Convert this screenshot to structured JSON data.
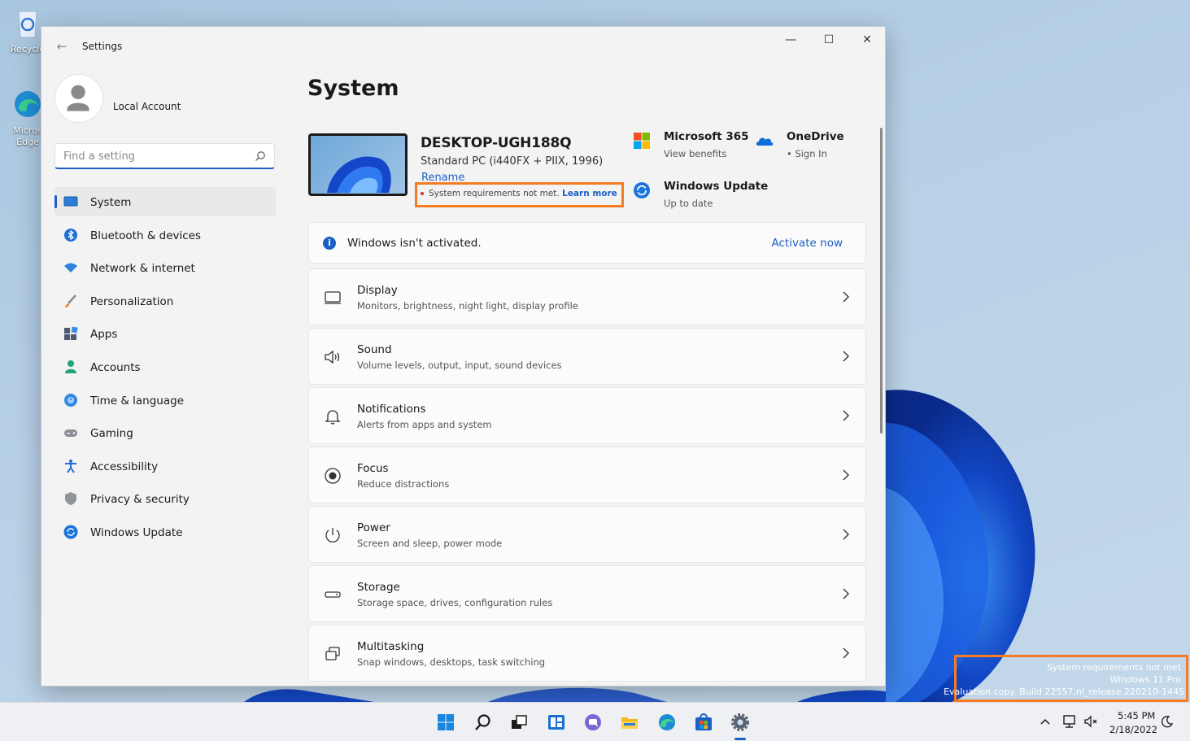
{
  "desktop": {
    "icons": [
      {
        "label": "Recycle"
      },
      {
        "label": "Micros Edge"
      }
    ]
  },
  "window": {
    "app_title": "Settings",
    "minimize_glyph": "—",
    "maximize_glyph": "☐",
    "close_glyph": "✕",
    "back_glyph": "←"
  },
  "sidebar": {
    "account_name": "Local Account",
    "search": {
      "placeholder": "Find a setting",
      "value": ""
    },
    "items": [
      {
        "label": "System",
        "icon": "system-icon",
        "active": true
      },
      {
        "label": "Bluetooth & devices",
        "icon": "bluetooth-icon"
      },
      {
        "label": "Network & internet",
        "icon": "wifi-icon"
      },
      {
        "label": "Personalization",
        "icon": "brush-icon"
      },
      {
        "label": "Apps",
        "icon": "apps-icon"
      },
      {
        "label": "Accounts",
        "icon": "account-icon"
      },
      {
        "label": "Time & language",
        "icon": "globe-clock-icon"
      },
      {
        "label": "Gaming",
        "icon": "gamepad-icon"
      },
      {
        "label": "Accessibility",
        "icon": "accessibility-icon"
      },
      {
        "label": "Privacy & security",
        "icon": "shield-icon"
      },
      {
        "label": "Windows Update",
        "icon": "update-icon"
      }
    ]
  },
  "main": {
    "page_title": "System",
    "device": {
      "name": "DESKTOP-UGH188Q",
      "model": "Standard PC (i440FX + PIIX, 1996)",
      "rename_label": "Rename",
      "requirements_text": "System requirements not met.",
      "learn_more_label": "Learn more"
    },
    "quick_links": [
      {
        "title": "Microsoft 365",
        "subtitle": "View benefits",
        "icon": "microsoft-logo-icon"
      },
      {
        "title": "OneDrive",
        "subtitle": "• Sign In",
        "icon": "onedrive-cloud-icon"
      },
      {
        "title": "Windows Update",
        "subtitle": "Up to date",
        "icon": "update-icon"
      }
    ],
    "activation": {
      "message": "Windows isn't activated.",
      "action_label": "Activate now",
      "icon_glyph": "i"
    },
    "cards": [
      {
        "title": "Display",
        "subtitle": "Monitors, brightness, night light, display profile",
        "icon": "display-icon"
      },
      {
        "title": "Sound",
        "subtitle": "Volume levels, output, input, sound devices",
        "icon": "speaker-icon"
      },
      {
        "title": "Notifications",
        "subtitle": "Alerts from apps and system",
        "icon": "bell-icon"
      },
      {
        "title": "Focus",
        "subtitle": "Reduce distractions",
        "icon": "focus-icon"
      },
      {
        "title": "Power",
        "subtitle": "Screen and sleep, power mode",
        "icon": "power-icon"
      },
      {
        "title": "Storage",
        "subtitle": "Storage space, drives, configuration rules",
        "icon": "storage-icon"
      },
      {
        "title": "Multitasking",
        "subtitle": "Snap windows, desktops, task switching",
        "icon": "multitasking-icon"
      }
    ]
  },
  "watermark": {
    "line1": "System requirements not met",
    "line2": "Windows 11 Pro",
    "line3": "Evaluation copy. Build 22557.ni_release.220210-1445"
  },
  "taskbar": {
    "apps": [
      "start-icon",
      "search-icon",
      "task-view-icon",
      "widgets-icon",
      "teams-chat-icon",
      "file-explorer-icon",
      "edge-icon",
      "store-icon",
      "settings-icon"
    ],
    "clock_time": "5:45 PM",
    "clock_date": "2/18/2022"
  },
  "colors": {
    "accent": "#1c5fc4",
    "highlight_box": "#f57c22",
    "window_bg": "#f3f3f3",
    "card_bg": "#fbfbfb"
  }
}
